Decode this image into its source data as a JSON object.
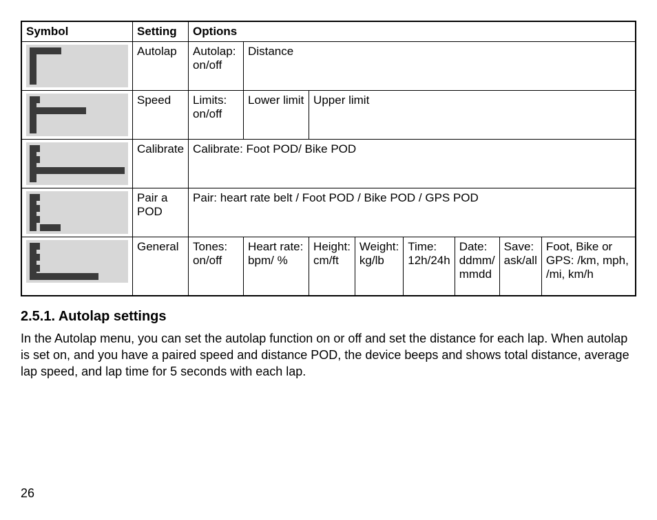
{
  "table": {
    "headers": {
      "symbol": "Symbol",
      "setting": "Setting",
      "options": "Options"
    },
    "rows": {
      "autolap": {
        "setting": "Autolap",
        "c1": "Autolap: on/off",
        "c2": "Distance"
      },
      "speed": {
        "setting": "Speed",
        "c1": "Limits: on/off",
        "c2": "Lower limit",
        "c3": "Upper limit"
      },
      "calibrate": {
        "setting": "Calibrate",
        "merged": "Calibrate: Foot POD/ Bike POD"
      },
      "pair": {
        "setting": "Pair a POD",
        "merged": "Pair: heart rate belt / Foot POD / Bike POD / GPS POD"
      },
      "general": {
        "setting": "General",
        "c1": "Tones: on/off",
        "c2": "Heart rate: bpm/ %",
        "c3": "Height: cm/ft",
        "c4": "Weight: kg/lb",
        "c5": "Time: 12h/24h",
        "c6": "Date: ddmm/ mmdd",
        "c7": "Save: ask/all",
        "c8": "Foot, Bike or GPS: /km, mph, /mi, km/h"
      }
    }
  },
  "section": {
    "heading": "2.5.1. Autolap settings",
    "body": "In the Autolap menu, you can set the autolap function on or off and set the distance for each lap. When autolap is set on, and you have a paired speed and distance POD, the device beeps and shows total distance, average lap speed, and lap time for 5 seconds with each lap."
  },
  "page_number": "26"
}
